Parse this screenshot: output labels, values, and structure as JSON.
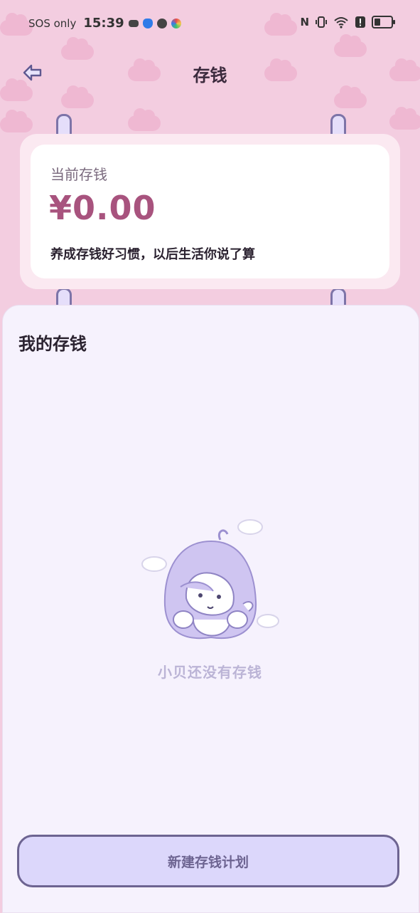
{
  "status_bar": {
    "sos": "SOS only",
    "time": "15:39",
    "battery_level": 0.35
  },
  "nav": {
    "title": "存钱",
    "back_icon": "arrow-left-icon"
  },
  "savings_card": {
    "label": "当前存钱",
    "amount": "¥0.00",
    "tip": "养成存钱好习惯，以后生活你说了算"
  },
  "my_savings": {
    "title": "我的存钱",
    "empty_text": "小贝还没有存钱"
  },
  "actions": {
    "create_plan": "新建存钱计划"
  },
  "colors": {
    "background_pink": "#f3cde0",
    "amount": "#a8537e",
    "button_fill": "#dcd7fb",
    "button_border": "#6d6491",
    "panel": "#f6f2fd"
  }
}
